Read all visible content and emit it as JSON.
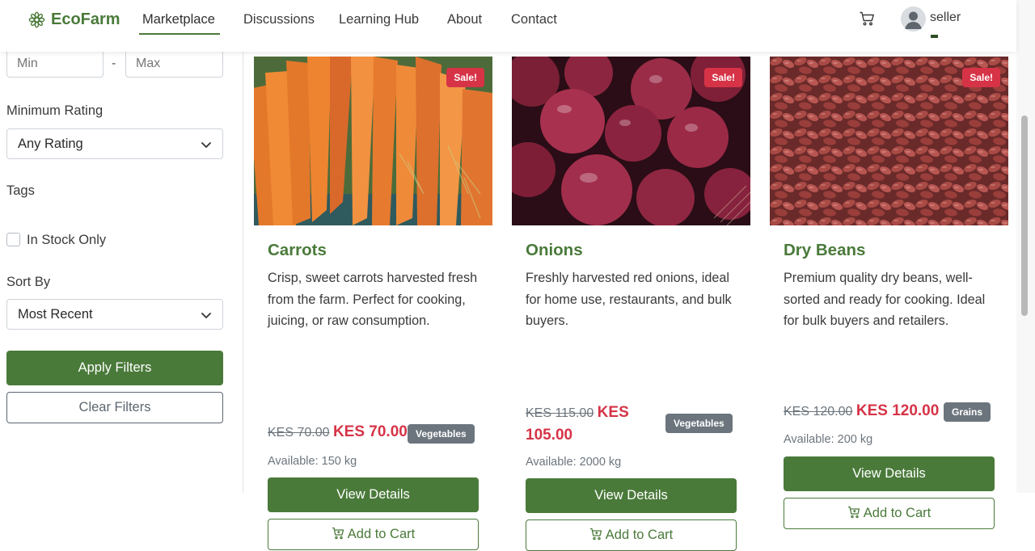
{
  "nav": {
    "brand": "EcoFarm",
    "links": [
      "Marketplace",
      "Discussions",
      "Learning Hub",
      "About",
      "Contact"
    ],
    "user": "seller"
  },
  "sidebar": {
    "min_placeholder": "Min",
    "max_placeholder": "Max",
    "price_separator": "-",
    "rating_label": "Minimum Rating",
    "rating_value": "Any Rating",
    "tags_label": "Tags",
    "in_stock_label": "In Stock Only",
    "sort_label": "Sort By",
    "sort_value": "Most Recent",
    "apply_label": "Apply Filters",
    "clear_label": "Clear Filters"
  },
  "products": [
    {
      "title": "Carrots",
      "sale": "Sale!",
      "description": "Crisp, sweet carrots harvested fresh from the farm. Perfect for cooking, juicing, or raw consumption.",
      "old_price": "KES 70.00",
      "new_price": "KES 70.00",
      "tag": "Vegetables",
      "available": "Available: 150 kg",
      "view_label": "View Details",
      "cart_label": "Add to Cart"
    },
    {
      "title": "Onions",
      "sale": "Sale!",
      "description": "Freshly harvested red onions, ideal for home use, restaurants, and bulk buyers.",
      "old_price": "KES 115.00",
      "new_price": "KES 105.00",
      "tag": "Vegetables",
      "available": "Available: 2000 kg",
      "view_label": "View Details",
      "cart_label": "Add to Cart"
    },
    {
      "title": "Dry Beans",
      "sale": "Sale!",
      "description": "Premium quality dry beans, well-sorted and ready for cooking. Ideal for bulk buyers and retailers.",
      "old_price": "KES 120.00",
      "new_price": "KES 120.00",
      "tag": "Grains",
      "available": "Available: 200 kg",
      "view_label": "View Details",
      "cart_label": "Add to Cart"
    }
  ],
  "colors": {
    "brand_green": "#4a7a3a",
    "sale_red": "#d63347",
    "tag_gray": "#6c757d"
  }
}
